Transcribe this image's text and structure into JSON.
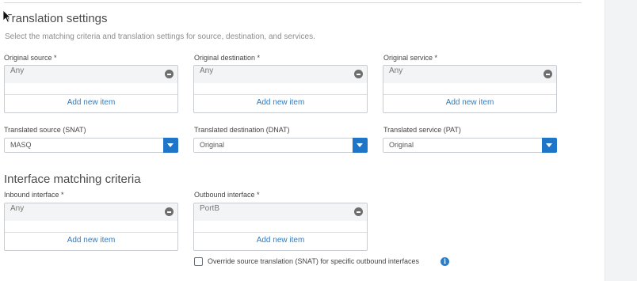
{
  "translation": {
    "title": "Translation settings",
    "description": "Select the matching criteria and translation settings for source, destination, and services.",
    "original_source": {
      "label": "Original source *",
      "item": "Any",
      "add_label": "Add new item"
    },
    "original_destination": {
      "label": "Original destination *",
      "item": "Any",
      "add_label": "Add new item"
    },
    "original_service": {
      "label": "Original service *",
      "item": "Any",
      "add_label": "Add new item"
    },
    "translated_source": {
      "label": "Translated source (SNAT)",
      "value": "MASQ"
    },
    "translated_destination": {
      "label": "Translated destination (DNAT)",
      "value": "Original"
    },
    "translated_service": {
      "label": "Translated service (PAT)",
      "value": "Original"
    }
  },
  "interface": {
    "title": "Interface matching criteria",
    "inbound": {
      "label": "Inbound interface *",
      "item": "Any",
      "add_label": "Add new item"
    },
    "outbound": {
      "label": "Outbound interface *",
      "item": "PortB",
      "add_label": "Add new item"
    },
    "override_label": "Override source translation (SNAT) for specific outbound interfaces",
    "override_checked": false
  },
  "icons": {
    "remove": "minus-circle-icon",
    "dropdown": "chevron-down-icon",
    "info": "info-icon",
    "cursor": "mouse-pointer-icon"
  },
  "colors": {
    "accent": "#1f76c8",
    "link": "#2d7cc4",
    "remove_icon": "#6e6e6e"
  }
}
